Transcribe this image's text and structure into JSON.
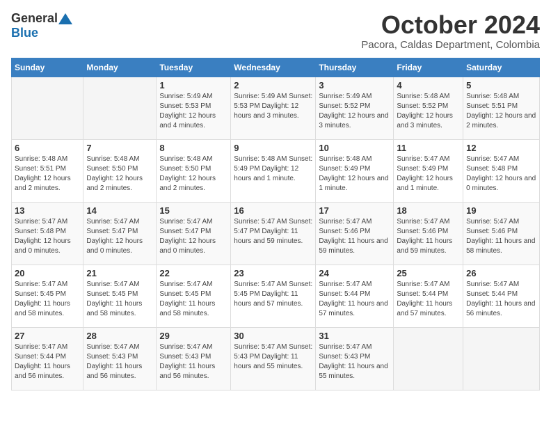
{
  "header": {
    "logo_general": "General",
    "logo_blue": "Blue",
    "month_title": "October 2024",
    "location": "Pacora, Caldas Department, Colombia"
  },
  "days_of_week": [
    "Sunday",
    "Monday",
    "Tuesday",
    "Wednesday",
    "Thursday",
    "Friday",
    "Saturday"
  ],
  "weeks": [
    [
      {
        "day": "",
        "info": ""
      },
      {
        "day": "",
        "info": ""
      },
      {
        "day": "1",
        "info": "Sunrise: 5:49 AM\nSunset: 5:53 PM\nDaylight: 12 hours and 4 minutes."
      },
      {
        "day": "2",
        "info": "Sunrise: 5:49 AM\nSunset: 5:53 PM\nDaylight: 12 hours and 3 minutes."
      },
      {
        "day": "3",
        "info": "Sunrise: 5:49 AM\nSunset: 5:52 PM\nDaylight: 12 hours and 3 minutes."
      },
      {
        "day": "4",
        "info": "Sunrise: 5:48 AM\nSunset: 5:52 PM\nDaylight: 12 hours and 3 minutes."
      },
      {
        "day": "5",
        "info": "Sunrise: 5:48 AM\nSunset: 5:51 PM\nDaylight: 12 hours and 2 minutes."
      }
    ],
    [
      {
        "day": "6",
        "info": "Sunrise: 5:48 AM\nSunset: 5:51 PM\nDaylight: 12 hours and 2 minutes."
      },
      {
        "day": "7",
        "info": "Sunrise: 5:48 AM\nSunset: 5:50 PM\nDaylight: 12 hours and 2 minutes."
      },
      {
        "day": "8",
        "info": "Sunrise: 5:48 AM\nSunset: 5:50 PM\nDaylight: 12 hours and 2 minutes."
      },
      {
        "day": "9",
        "info": "Sunrise: 5:48 AM\nSunset: 5:49 PM\nDaylight: 12 hours and 1 minute."
      },
      {
        "day": "10",
        "info": "Sunrise: 5:48 AM\nSunset: 5:49 PM\nDaylight: 12 hours and 1 minute."
      },
      {
        "day": "11",
        "info": "Sunrise: 5:47 AM\nSunset: 5:49 PM\nDaylight: 12 hours and 1 minute."
      },
      {
        "day": "12",
        "info": "Sunrise: 5:47 AM\nSunset: 5:48 PM\nDaylight: 12 hours and 0 minutes."
      }
    ],
    [
      {
        "day": "13",
        "info": "Sunrise: 5:47 AM\nSunset: 5:48 PM\nDaylight: 12 hours and 0 minutes."
      },
      {
        "day": "14",
        "info": "Sunrise: 5:47 AM\nSunset: 5:47 PM\nDaylight: 12 hours and 0 minutes."
      },
      {
        "day": "15",
        "info": "Sunrise: 5:47 AM\nSunset: 5:47 PM\nDaylight: 12 hours and 0 minutes."
      },
      {
        "day": "16",
        "info": "Sunrise: 5:47 AM\nSunset: 5:47 PM\nDaylight: 11 hours and 59 minutes."
      },
      {
        "day": "17",
        "info": "Sunrise: 5:47 AM\nSunset: 5:46 PM\nDaylight: 11 hours and 59 minutes."
      },
      {
        "day": "18",
        "info": "Sunrise: 5:47 AM\nSunset: 5:46 PM\nDaylight: 11 hours and 59 minutes."
      },
      {
        "day": "19",
        "info": "Sunrise: 5:47 AM\nSunset: 5:46 PM\nDaylight: 11 hours and 58 minutes."
      }
    ],
    [
      {
        "day": "20",
        "info": "Sunrise: 5:47 AM\nSunset: 5:45 PM\nDaylight: 11 hours and 58 minutes."
      },
      {
        "day": "21",
        "info": "Sunrise: 5:47 AM\nSunset: 5:45 PM\nDaylight: 11 hours and 58 minutes."
      },
      {
        "day": "22",
        "info": "Sunrise: 5:47 AM\nSunset: 5:45 PM\nDaylight: 11 hours and 58 minutes."
      },
      {
        "day": "23",
        "info": "Sunrise: 5:47 AM\nSunset: 5:45 PM\nDaylight: 11 hours and 57 minutes."
      },
      {
        "day": "24",
        "info": "Sunrise: 5:47 AM\nSunset: 5:44 PM\nDaylight: 11 hours and 57 minutes."
      },
      {
        "day": "25",
        "info": "Sunrise: 5:47 AM\nSunset: 5:44 PM\nDaylight: 11 hours and 57 minutes."
      },
      {
        "day": "26",
        "info": "Sunrise: 5:47 AM\nSunset: 5:44 PM\nDaylight: 11 hours and 56 minutes."
      }
    ],
    [
      {
        "day": "27",
        "info": "Sunrise: 5:47 AM\nSunset: 5:44 PM\nDaylight: 11 hours and 56 minutes."
      },
      {
        "day": "28",
        "info": "Sunrise: 5:47 AM\nSunset: 5:43 PM\nDaylight: 11 hours and 56 minutes."
      },
      {
        "day": "29",
        "info": "Sunrise: 5:47 AM\nSunset: 5:43 PM\nDaylight: 11 hours and 56 minutes."
      },
      {
        "day": "30",
        "info": "Sunrise: 5:47 AM\nSunset: 5:43 PM\nDaylight: 11 hours and 55 minutes."
      },
      {
        "day": "31",
        "info": "Sunrise: 5:47 AM\nSunset: 5:43 PM\nDaylight: 11 hours and 55 minutes."
      },
      {
        "day": "",
        "info": ""
      },
      {
        "day": "",
        "info": ""
      }
    ]
  ]
}
